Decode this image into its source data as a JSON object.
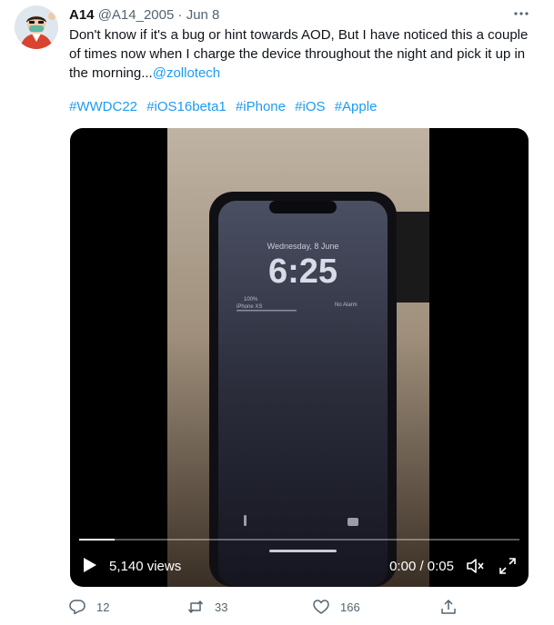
{
  "tweet": {
    "author_name": "A14",
    "handle": "@A14_2005",
    "separator": "·",
    "date": "Jun 8",
    "text": "Don't know if it's a bug or hint towards AOD, But I have noticed this a couple of times now when I charge the device throughout the night and pick it up in the morning...",
    "mention": "@zollotech",
    "hashtags": [
      "#WWDC22",
      "#iOS16beta1",
      "#iPhone",
      "#iOS",
      "#Apple"
    ]
  },
  "video": {
    "lock_date": "Wednesday, 8 June",
    "lock_time": "6:25",
    "battery_text": "100%",
    "device_text": "iPhone XS",
    "alarm_text": "No Alarm",
    "views": "5,140 views",
    "time_display": "0:00 / 0:05",
    "progress_fraction": 0.08
  },
  "actions": {
    "replies": "12",
    "retweets": "33",
    "likes": "166"
  },
  "icons": [
    "more-icon",
    "play-icon",
    "volume-icon",
    "fullscreen-icon",
    "reply-icon",
    "retweet-icon",
    "like-icon",
    "share-icon"
  ],
  "colors": {
    "link": "#1d9bf0",
    "muted": "#536471",
    "text": "#0f1419"
  }
}
